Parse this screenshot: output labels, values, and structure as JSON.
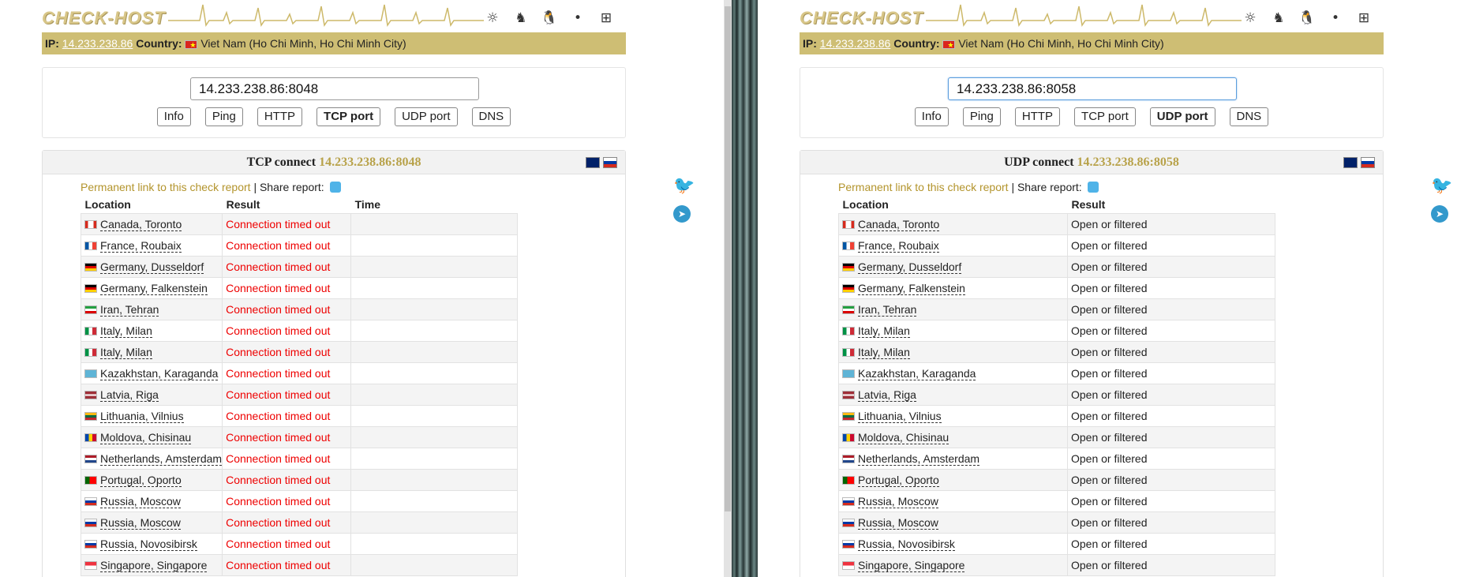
{
  "colors": {
    "ipbar": "#cebe74",
    "logo": "#d8c688",
    "target": "#b8a24a",
    "error": "#ee0000"
  },
  "left": {
    "logo": "CHECK-HOST",
    "ip_label": "IP:",
    "ip": "14.233.238.86",
    "country_label": "Country:",
    "country": "Viet Nam (Ho Chi Minh, Ho Chi Minh City)",
    "host_value": "14.233.238.86:8048",
    "buttons": [
      "Info",
      "Ping",
      "HTTP",
      "TCP port",
      "UDP port",
      "DNS"
    ],
    "active_button": "TCP port",
    "result_title": "TCP connect",
    "result_target": "14.233.238.86:8048",
    "permanent_link": "Permanent link to this check report",
    "separator": "|",
    "share_report": "Share report:",
    "columns": [
      "Location",
      "Result",
      "Time"
    ],
    "result_text": "Connection timed out"
  },
  "right": {
    "logo": "CHECK-HOST",
    "ip_label": "IP:",
    "ip": "14.233.238.86",
    "country_label": "Country:",
    "country": "Viet Nam (Ho Chi Minh, Ho Chi Minh City)",
    "host_value": "14.233.238.86:8058",
    "buttons": [
      "Info",
      "Ping",
      "HTTP",
      "TCP port",
      "UDP port",
      "DNS"
    ],
    "active_button": "UDP port",
    "result_title": "UDP connect",
    "result_target": "14.233.238.86:8058",
    "permanent_link": "Permanent link to this check report",
    "separator": "|",
    "share_report": "Share report:",
    "columns": [
      "Location",
      "Result"
    ],
    "result_text": "Open or filtered"
  },
  "locations": [
    {
      "name": "Canada, Toronto",
      "flag": "ca"
    },
    {
      "name": "France, Roubaix",
      "flag": "fr"
    },
    {
      "name": "Germany, Dusseldorf",
      "flag": "de"
    },
    {
      "name": "Germany, Falkenstein",
      "flag": "de"
    },
    {
      "name": "Iran, Tehran",
      "flag": "ir"
    },
    {
      "name": "Italy, Milan",
      "flag": "it"
    },
    {
      "name": "Italy, Milan",
      "flag": "it"
    },
    {
      "name": "Kazakhstan, Karaganda",
      "flag": "kz"
    },
    {
      "name": "Latvia, Riga",
      "flag": "lv"
    },
    {
      "name": "Lithuania, Vilnius",
      "flag": "lt"
    },
    {
      "name": "Moldova, Chisinau",
      "flag": "md"
    },
    {
      "name": "Netherlands, Amsterdam",
      "flag": "nl"
    },
    {
      "name": "Portugal, Oporto",
      "flag": "pt"
    },
    {
      "name": "Russia, Moscow",
      "flag": "ru"
    },
    {
      "name": "Russia, Moscow",
      "flag": "ru"
    },
    {
      "name": "Russia, Novosibirsk",
      "flag": "ru"
    },
    {
      "name": "Singapore, Singapore",
      "flag": "sg"
    }
  ],
  "os_icons": [
    "globe-icon",
    "bird-icon",
    "linux-icon",
    "apple-icon",
    "windows-icon"
  ]
}
